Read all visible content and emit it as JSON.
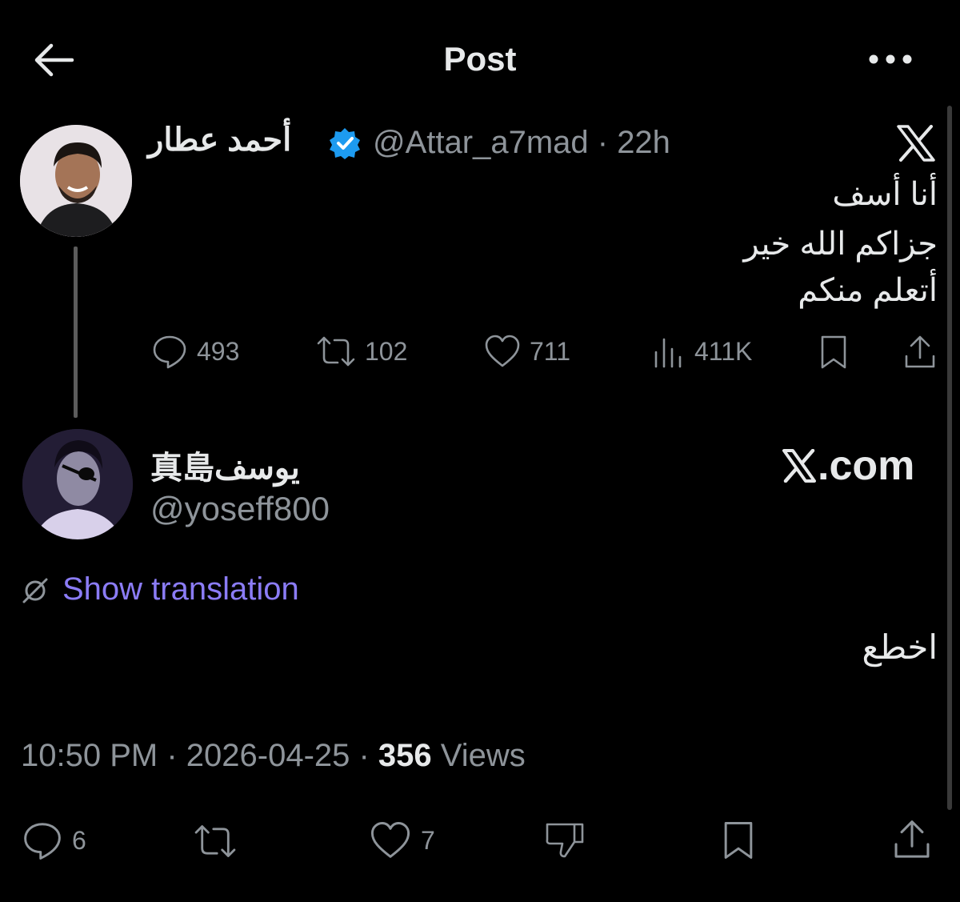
{
  "header": {
    "title": "Post",
    "back_icon": "arrow-left-icon",
    "more_icon": "more-dots-icon"
  },
  "parent_tweet": {
    "display_name": "أحمد عطار",
    "verified": true,
    "handle": "@Attar_a7mad",
    "time": "22h",
    "lines": [
      "أنا أسف",
      "جزاكم الله خير",
      "أتعلم منكم"
    ],
    "stats": {
      "replies": "493",
      "reposts": "102",
      "likes": "711",
      "views": "411K"
    }
  },
  "reply_tweet": {
    "display_name": "真島يوسف",
    "handle": "@yoseff800",
    "watermark": ".com",
    "show_translation": "Show translation",
    "text": "اخطع",
    "time": "10:50 PM",
    "date": "2026-04-25",
    "views_count": "356",
    "views_label": "Views",
    "stats": {
      "replies": "6",
      "likes": "7"
    }
  },
  "colors": {
    "background": "#000000",
    "text": "#e7e9ea",
    "muted": "#8e949a",
    "link": "#8b7cf6",
    "verified": "#1d9bf0"
  }
}
